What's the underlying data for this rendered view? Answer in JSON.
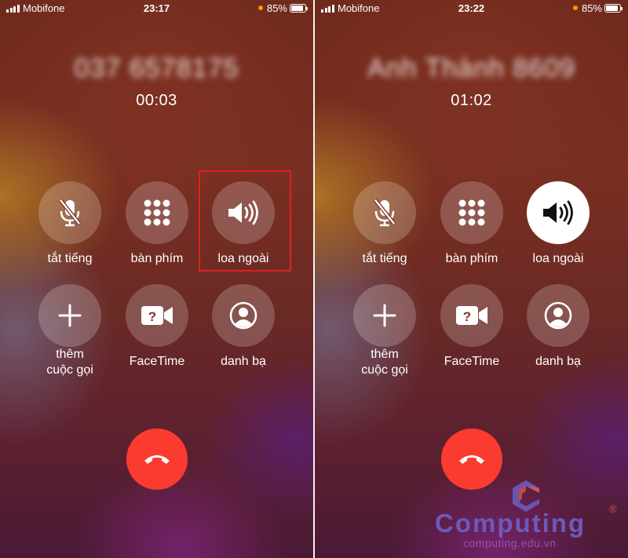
{
  "icons": {
    "signal": "cellular-signal-icon",
    "location": "orange-indicator-dot",
    "battery": "battery-icon",
    "mute": "microphone-slash-icon",
    "keypad": "keypad-grid-icon",
    "speaker": "speaker-wave-icon",
    "add": "plus-icon",
    "facetime": "facetime-video-question-icon",
    "contacts": "person-circle-icon",
    "end_call": "phone-hangup-icon"
  },
  "colors": {
    "end_call": "#fb3b30",
    "battery_indicator": "#ff9500",
    "highlight_box": "#e02020",
    "button_bg": "rgba(255,255,255,0.2)",
    "button_active_bg": "#ffffff"
  },
  "screens": [
    {
      "status": {
        "carrier": "Mobifone",
        "time": "23:17",
        "battery_pct": "85%",
        "battery_level": 0.85
      },
      "call": {
        "caller": "037 6578175",
        "duration": "00:03"
      },
      "buttons": {
        "mute": "tắt tiếng",
        "keypad": "bàn phím",
        "speaker": "loa ngoài",
        "add_call": "thêm\ncuộc gọi",
        "facetime": "FaceTime",
        "contacts": "danh bạ"
      },
      "speaker_active": false,
      "speaker_highlighted": true
    },
    {
      "status": {
        "carrier": "Mobifone",
        "time": "23:22",
        "battery_pct": "85%",
        "battery_level": 0.85
      },
      "call": {
        "caller": "Anh Thành 8609",
        "duration": "01:02"
      },
      "buttons": {
        "mute": "tắt tiếng",
        "keypad": "bàn phím",
        "speaker": "loa ngoài",
        "add_call": "thêm\ncuộc gọi",
        "facetime": "FaceTime",
        "contacts": "danh bạ"
      },
      "speaker_active": true,
      "speaker_highlighted": false
    }
  ],
  "watermark": {
    "brand": "Computing",
    "registered": "®",
    "url": "computing.edu.vn"
  }
}
